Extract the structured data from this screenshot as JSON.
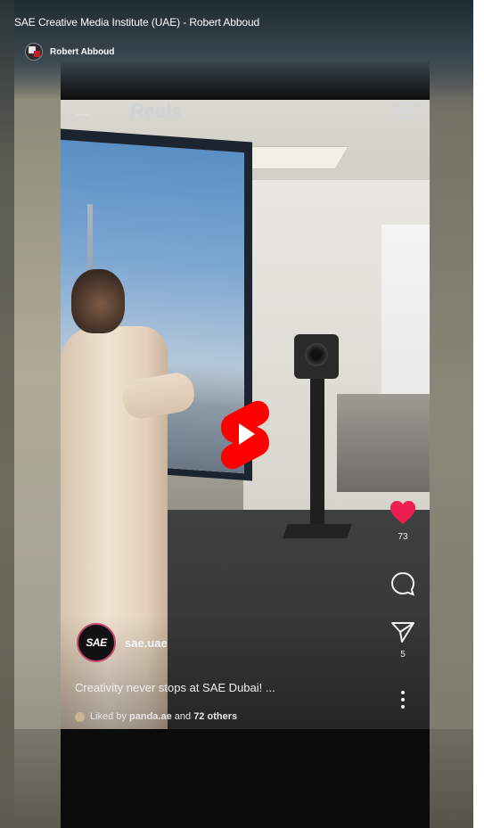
{
  "video": {
    "title": "SAE Creative Media Institute (UAE) - Robert Abboud",
    "channel_name": "Robert Abboud"
  },
  "reels": {
    "header_title": "Reels",
    "back_icon": "back-arrow-icon",
    "camera_icon": "camera-icon"
  },
  "post": {
    "account_name": "sae.uae",
    "avatar_text": "SAE",
    "caption": "Creativity never stops at SAE Dubai! ...",
    "liked_prefix": "Liked by ",
    "liked_user": "panda.ae",
    "liked_mid": " and ",
    "liked_others": "72 others"
  },
  "actions": {
    "likes": "73",
    "shares": "5",
    "like_color": "#ee1d52"
  },
  "colors": {
    "shorts_red": "#ff0000",
    "accent_pink": "#c8476c"
  }
}
